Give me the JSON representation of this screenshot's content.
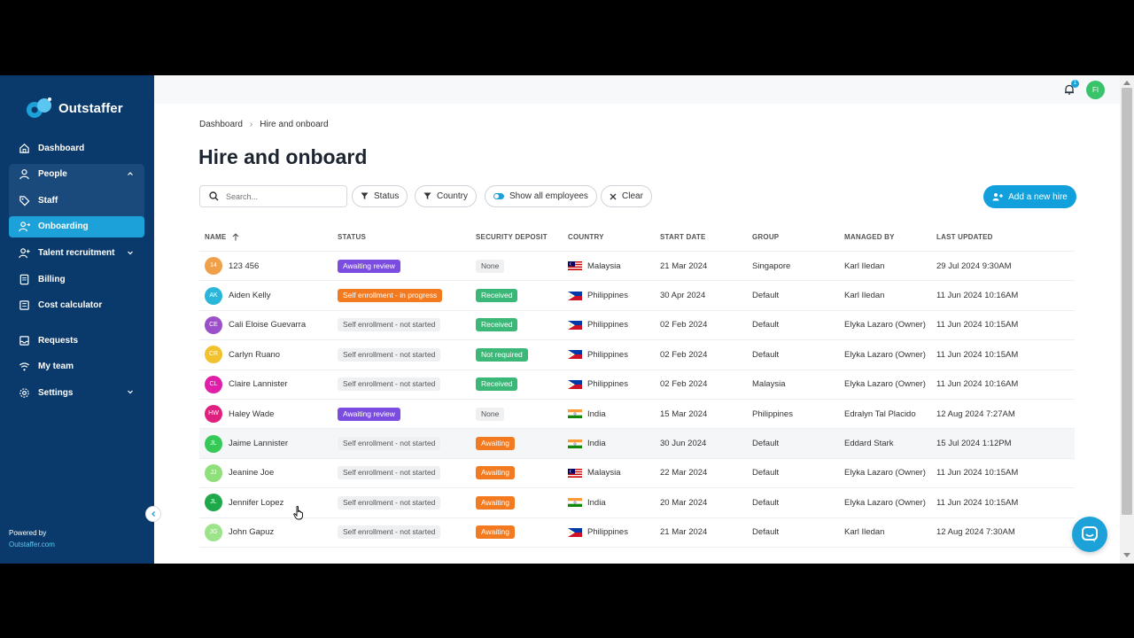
{
  "brand": {
    "name": "Outstaffer"
  },
  "sidebar": {
    "items": [
      {
        "label": "Dashboard",
        "icon": "home-icon"
      },
      {
        "label": "People",
        "icon": "user-icon"
      },
      {
        "label": "Staff",
        "icon": "tag-icon"
      },
      {
        "label": "Onboarding",
        "icon": "user-arrow-icon"
      },
      {
        "label": "Talent recruitment",
        "icon": "user-plus-icon"
      },
      {
        "label": "Billing",
        "icon": "document-icon"
      },
      {
        "label": "Cost calculator",
        "icon": "calculator-icon"
      },
      {
        "label": "Requests",
        "icon": "inbox-icon"
      },
      {
        "label": "My team",
        "icon": "wifi-icon"
      },
      {
        "label": "Settings",
        "icon": "gear-icon"
      }
    ],
    "powered_by": "Powered by",
    "powered_link": "Outstaffer.com"
  },
  "topbar": {
    "notification_count": "1",
    "user_initials": "FI"
  },
  "breadcrumb": {
    "root": "Dashboard",
    "current": "Hire and onboard"
  },
  "page": {
    "title": "Hire and onboard"
  },
  "toolbar": {
    "search_placeholder": "Search...",
    "status_label": "Status",
    "country_label": "Country",
    "show_all_label": "Show all employees",
    "clear_label": "Clear",
    "add_label": "Add a new hire"
  },
  "table": {
    "headers": {
      "name": "NAME",
      "status": "STATUS",
      "deposit": "SECURITY DEPOSIT",
      "country": "COUNTRY",
      "start": "START DATE",
      "group": "GROUP",
      "managed": "MANAGED BY",
      "updated": "LAST UPDATED"
    },
    "rows": [
      {
        "initials": "14",
        "avatar_color": "#f0a04b",
        "name": "123 456",
        "status": "Awaiting review",
        "status_kind": "review",
        "deposit": "None",
        "deposit_kind": "none",
        "flag": "my",
        "country": "Malaysia",
        "start": "21 Mar 2024",
        "group": "Singapore",
        "managed": "Karl Iledan",
        "updated": "29 Jul 2024 9:30AM"
      },
      {
        "initials": "AK",
        "avatar_color": "#29b6d8",
        "name": "Aiden Kelly",
        "status": "Self enrollment - in progress",
        "status_kind": "progress",
        "deposit": "Received",
        "deposit_kind": "received",
        "flag": "ph",
        "country": "Philippines",
        "start": "30 Apr 2024",
        "group": "Default",
        "managed": "Karl Iledan",
        "updated": "11 Jun 2024 10:16AM"
      },
      {
        "initials": "CE",
        "avatar_color": "#9b4fc8",
        "name": "Cali Eloise Guevarra",
        "status": "Self enrollment - not started",
        "status_kind": "notstarted",
        "deposit": "Received",
        "deposit_kind": "received",
        "flag": "ph",
        "country": "Philippines",
        "start": "02 Feb 2024",
        "group": "Default",
        "managed": "Elyka Lazaro (Owner)",
        "updated": "11 Jun 2024 10:15AM"
      },
      {
        "initials": "CR",
        "avatar_color": "#f2c12e",
        "name": "Carlyn Ruano",
        "status": "Self enrollment - not started",
        "status_kind": "notstarted",
        "deposit": "Not required",
        "deposit_kind": "received",
        "flag": "ph",
        "country": "Philippines",
        "start": "02 Feb 2024",
        "group": "Default",
        "managed": "Elyka Lazaro (Owner)",
        "updated": "11 Jun 2024 10:15AM"
      },
      {
        "initials": "CL",
        "avatar_color": "#e01fa8",
        "name": "Claire Lannister",
        "status": "Self enrollment - not started",
        "status_kind": "notstarted",
        "deposit": "Received",
        "deposit_kind": "received",
        "flag": "ph",
        "country": "Philippines",
        "start": "02 Feb 2024",
        "group": "Malaysia",
        "managed": "Elyka Lazaro (Owner)",
        "updated": "11 Jun 2024 10:16AM"
      },
      {
        "initials": "HW",
        "avatar_color": "#e0207e",
        "name": "Haley Wade",
        "status": "Awaiting review",
        "status_kind": "review",
        "deposit": "None",
        "deposit_kind": "none",
        "flag": "in",
        "country": "India",
        "start": "15 Mar 2024",
        "group": "Philippines",
        "managed": "Edralyn Tal Placido",
        "updated": "12 Aug 2024 7:27AM"
      },
      {
        "initials": "JL",
        "avatar_color": "#36c957",
        "name": "Jaime Lannister",
        "status": "Self enrollment - not started",
        "status_kind": "notstarted",
        "deposit": "Awaiting",
        "deposit_kind": "awaiting",
        "flag": "in",
        "country": "India",
        "start": "30 Jun 2024",
        "group": "Default",
        "managed": "Eddard Stark",
        "updated": "15 Jul 2024 1:12PM"
      },
      {
        "initials": "JJ",
        "avatar_color": "#8fe07a",
        "name": "Jeanine Joe",
        "status": "Self enrollment - not started",
        "status_kind": "notstarted",
        "deposit": "Awaiting",
        "deposit_kind": "awaiting",
        "flag": "my",
        "country": "Malaysia",
        "start": "22 Mar 2024",
        "group": "Default",
        "managed": "Elyka Lazaro (Owner)",
        "updated": "11 Jun 2024 10:15AM"
      },
      {
        "initials": "JL",
        "avatar_color": "#1fa84a",
        "name": "Jennifer Lopez",
        "status": "Self enrollment - not started",
        "status_kind": "notstarted",
        "deposit": "Awaiting",
        "deposit_kind": "awaiting",
        "flag": "in",
        "country": "India",
        "start": "20 Mar 2024",
        "group": "Default",
        "managed": "Elyka Lazaro (Owner)",
        "updated": "11 Jun 2024 10:15AM"
      },
      {
        "initials": "JG",
        "avatar_color": "#9de38a",
        "name": "John Gapuz",
        "status": "Self enrollment - not started",
        "status_kind": "notstarted",
        "deposit": "Awaiting",
        "deposit_kind": "awaiting",
        "flag": "ph",
        "country": "Philippines",
        "start": "21 Mar 2024",
        "group": "Default",
        "managed": "Karl Iledan",
        "updated": "12 Aug 2024 7:30AM"
      }
    ]
  },
  "colors": {
    "sidebar_bg": "#0a3a6b",
    "accent": "#1ca1d8",
    "review": "#7b4ce0",
    "progress": "#f47a1f",
    "received": "#3bb878",
    "awaiting": "#f47a1f"
  }
}
